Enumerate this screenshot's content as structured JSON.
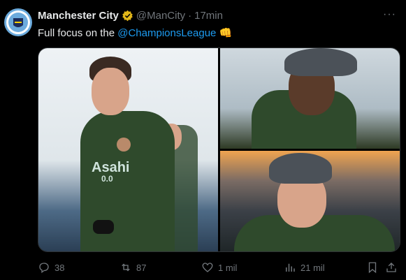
{
  "tweet": {
    "author_name": "Manchester City",
    "handle": "@ManCity",
    "separator": "·",
    "time": "17min",
    "text_before": "Full focus on the ",
    "mention": "@ChampionsLeague",
    "emoji": "👊",
    "more": "···"
  },
  "media": {
    "left_logo": "Asahi",
    "left_number": "0.0"
  },
  "actions": {
    "replies": "38",
    "reposts": "87",
    "likes": "1 mil",
    "views": "21 mil"
  },
  "colors": {
    "background": "#000000",
    "text": "#e7e9ea",
    "muted": "#71767b",
    "link": "#1d9bf0",
    "verified": "#e2b719"
  }
}
